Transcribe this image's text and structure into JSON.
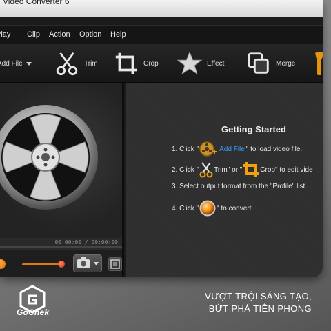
{
  "window": {
    "title": "Video Converter 6"
  },
  "menu": [
    "Play",
    "Clip",
    "Action",
    "Option",
    "Help"
  ],
  "toolbar": {
    "add_file": "Add File",
    "trim": "Trim",
    "crop": "Crop",
    "effect": "Effect",
    "merge": "Merge"
  },
  "player": {
    "time": "00:00:00 / 00:00:00",
    "volume": 0.85
  },
  "getting_started": {
    "title": "Getting Started",
    "step1_prefix": "1. Click \"",
    "step1_link": "Add File",
    "step1_suffix": "\" to load video file.",
    "step2_prefix": "2. Click \"",
    "step2_mid1": "Trim\" or \"",
    "step2_suffix": "Crop\" to edit vide",
    "step3": "3. Select output format from the \"Profile\" list.",
    "step4_prefix": "4. Click \"",
    "step4_suffix": "\" to convert."
  },
  "brand": {
    "name": "GoChek",
    "slogan_line1": "VƯỢT TRỘI SÁNG TẠO,",
    "slogan_line2": "BỨT PHÁ TIÊN PHONG"
  },
  "colors": {
    "accent": "#e88a10",
    "link": "#3aa0ff",
    "bg": "#1b1b1b"
  },
  "icons": [
    "add-file-icon",
    "scissors-icon",
    "crop-icon",
    "star-icon",
    "merge-icon",
    "film-reel-icon",
    "camera-icon",
    "fullscreen-icon",
    "convert-icon",
    "gochek-logo-icon"
  ]
}
